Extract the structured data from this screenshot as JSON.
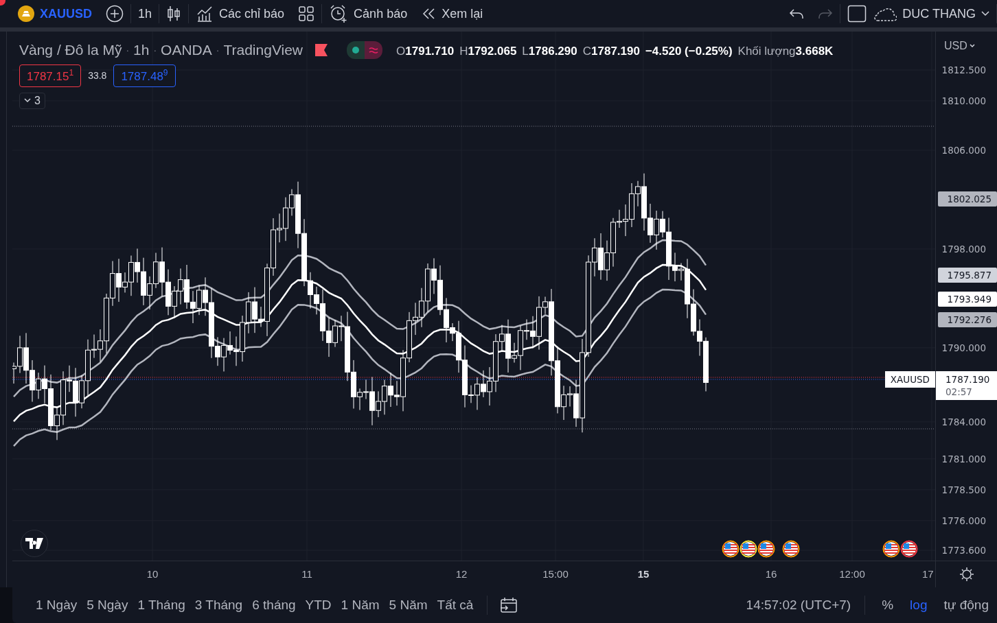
{
  "toolbar": {
    "symbol": "XAUUSD",
    "interval": "1h",
    "indicators": "Các chỉ báo",
    "alerts": "Cảnh báo",
    "replay": "Xem lại",
    "redo_disabled": true,
    "user": "DUC THANG"
  },
  "legend": {
    "title": "Vàng / Đô la Mỹ",
    "separators": [
      "·",
      "·",
      "·"
    ],
    "interval": "1h",
    "exchange": "OANDA",
    "source": "TradingView",
    "ohlc": [
      {
        "label": "O",
        "value": "1791.710"
      },
      {
        "label": "H",
        "value": "1792.065"
      },
      {
        "label": "L",
        "value": "1786.290"
      },
      {
        "label": "C",
        "value": "1787.190"
      }
    ],
    "change": "−4.520 (−0.25%)",
    "volume_label": "Khối lượng",
    "volume": "3.668K",
    "sell": "1787.15$^{1}$",
    "spread": "33.8",
    "buy": "1787.48$^{9}$",
    "collapsed_count": "3"
  },
  "price_axis": {
    "currency": "USD",
    "ticks": [
      {
        "label": "1812.500",
        "kind": "plain"
      },
      {
        "label": "1810.000",
        "kind": "plain"
      },
      {
        "label": "1806.000",
        "kind": "plain"
      },
      {
        "label": "1802.025",
        "kind": "marker",
        "color": "#b2b5be"
      },
      {
        "label": "1798.000",
        "kind": "plain"
      },
      {
        "label": "1795.877",
        "kind": "marker",
        "color": "#d1d4dc"
      },
      {
        "label": "1793.949",
        "kind": "marker",
        "color": "#ffffff"
      },
      {
        "label": "1792.276",
        "kind": "marker",
        "color": "#b2b5be"
      },
      {
        "label": "1790.000",
        "kind": "plain"
      },
      {
        "label": "1784.000",
        "kind": "plain"
      },
      {
        "label": "1781.000",
        "kind": "plain"
      },
      {
        "label": "1778.500",
        "kind": "plain"
      },
      {
        "label": "1776.000",
        "kind": "plain"
      },
      {
        "label": "1773.600",
        "kind": "plain"
      }
    ],
    "last_price": {
      "symbol": "XAUUSD",
      "price": "1787.190",
      "countdown": "02:57"
    }
  },
  "time_axis": [
    {
      "label": "10",
      "bold": false
    },
    {
      "label": "11",
      "bold": false
    },
    {
      "label": "12",
      "bold": false
    },
    {
      "label": "15:00",
      "bold": false
    },
    {
      "label": "15",
      "bold": true
    },
    {
      "label": "16",
      "bold": false
    },
    {
      "label": "12:00",
      "bold": false
    },
    {
      "label": "17",
      "bold": false
    }
  ],
  "events": [
    {
      "color": "#ff9800"
    },
    {
      "color": "#ffeb3b"
    },
    {
      "color": "#ff9800"
    },
    {
      "color": "#ff9800"
    },
    {
      "color": "#ff9800"
    },
    {
      "color": "#f23645"
    }
  ],
  "ranges": [
    "1 Ngày",
    "5 Ngày",
    "1 Tháng",
    "3 Tháng",
    "6 tháng",
    "YTD",
    "1 Năm",
    "5 Năm",
    "Tất cả"
  ],
  "clock": "14:57:02 (UTC+7)",
  "scale_options": [
    {
      "label": "%",
      "selected": false
    },
    {
      "label": "log",
      "selected": true
    },
    {
      "label": "tự động",
      "selected": false
    }
  ]
}
